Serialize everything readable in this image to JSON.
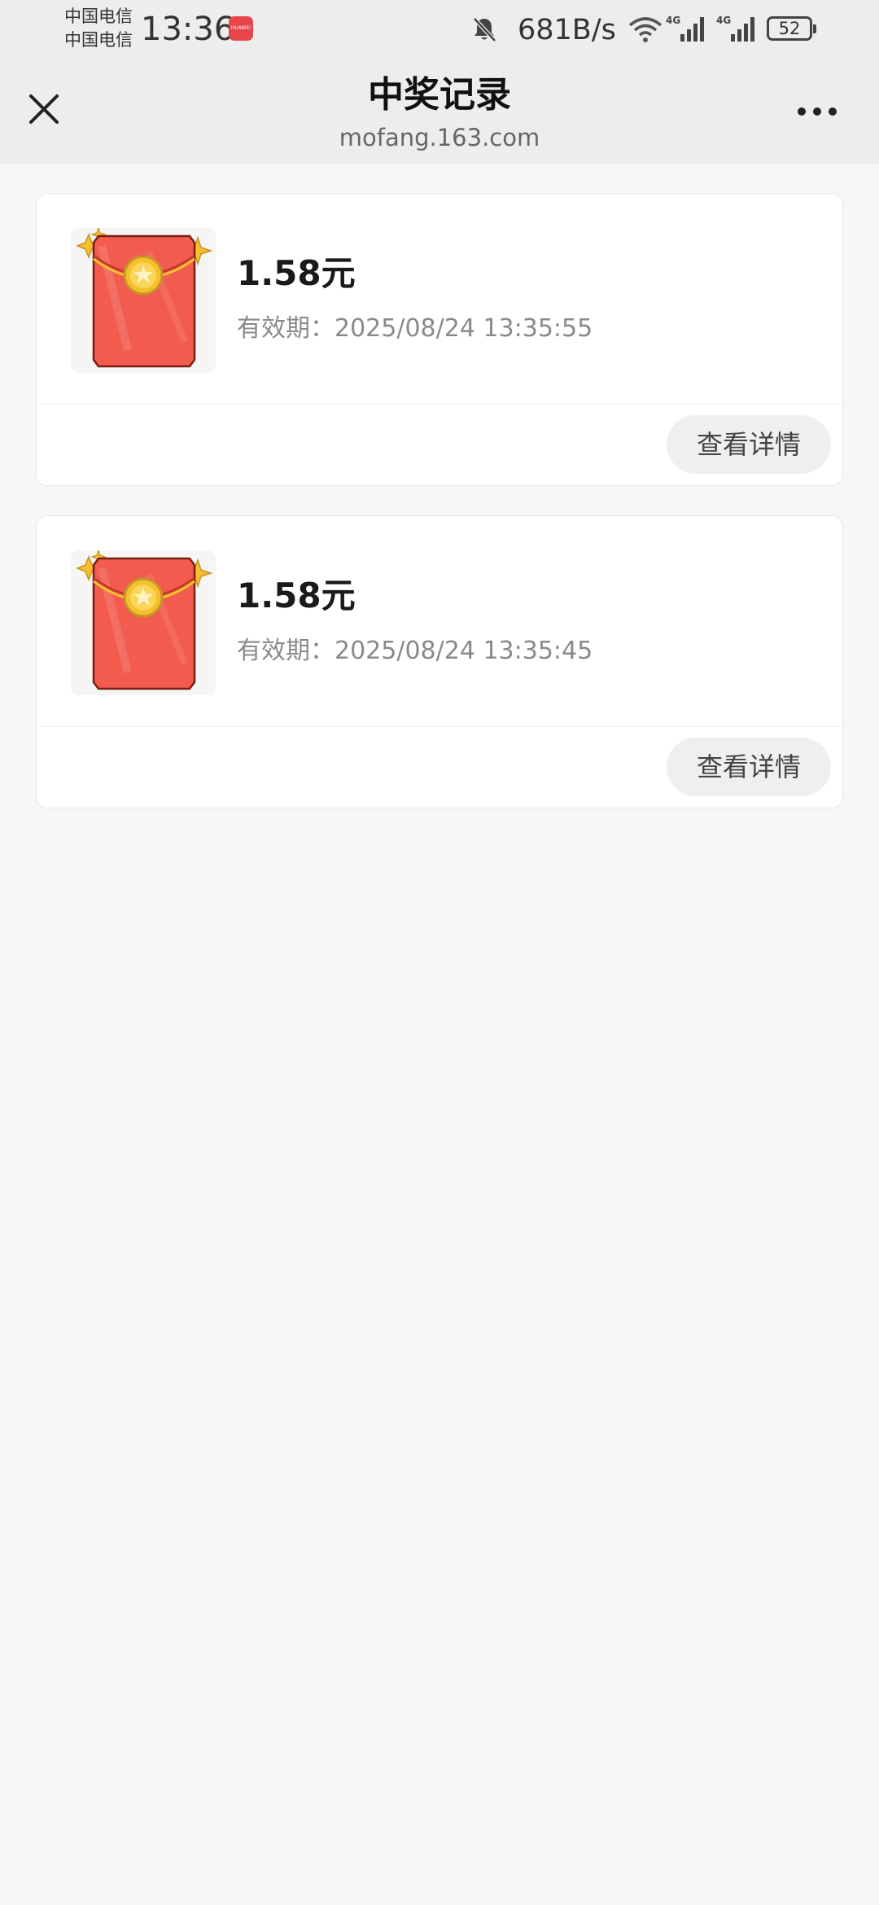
{
  "status_bar": {
    "carrier_1": "中国电信",
    "carrier_2": "中国电信",
    "time": "13:36",
    "app_badge_text": "HUAWEI",
    "network_speed": "681B/s",
    "signal_1_label": "4G",
    "signal_2_label": "4G",
    "battery": "52"
  },
  "nav": {
    "title": "中奖记录",
    "subtitle": "mofang.163.com",
    "close_icon": "close-icon",
    "more_icon": "more-icon"
  },
  "records": [
    {
      "amount": "1.58元",
      "validity": "有效期：2025/08/24 13:35:55",
      "button_label": "查看详情",
      "icon": "red-envelope-icon"
    },
    {
      "amount": "1.58元",
      "validity": "有效期：2025/08/24 13:35:45",
      "button_label": "查看详情",
      "icon": "red-envelope-icon"
    }
  ],
  "colors": {
    "envelope_red": "#f25b4e",
    "coin_gold": "#f6c02c",
    "background": "#f7f7f7"
  }
}
